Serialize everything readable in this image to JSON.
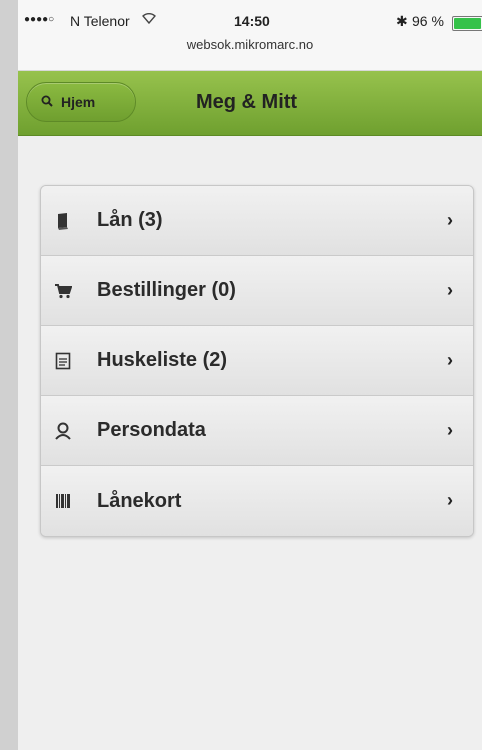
{
  "status": {
    "signal": "●●●●○",
    "carrier": "N Telenor",
    "time": "14:50",
    "bluetooth": "✱",
    "battery_pct": "96 %",
    "battery_level": 0.96
  },
  "url": "websok.mikromarc.no",
  "toolbar": {
    "home_label": "Hjem",
    "title": "Meg & Mitt"
  },
  "menu": {
    "items": [
      {
        "label": "Lån (3)",
        "icon": "book-icon"
      },
      {
        "label": "Bestillinger (0)",
        "icon": "cart-icon"
      },
      {
        "label": "Huskeliste (2)",
        "icon": "document-icon"
      },
      {
        "label": "Persondata",
        "icon": "person-icon"
      },
      {
        "label": "Lånekort",
        "icon": "barcode-icon"
      }
    ]
  },
  "colors": {
    "toolbar": "#7fae3a",
    "background": "#efefef",
    "battery": "#35c24a"
  }
}
